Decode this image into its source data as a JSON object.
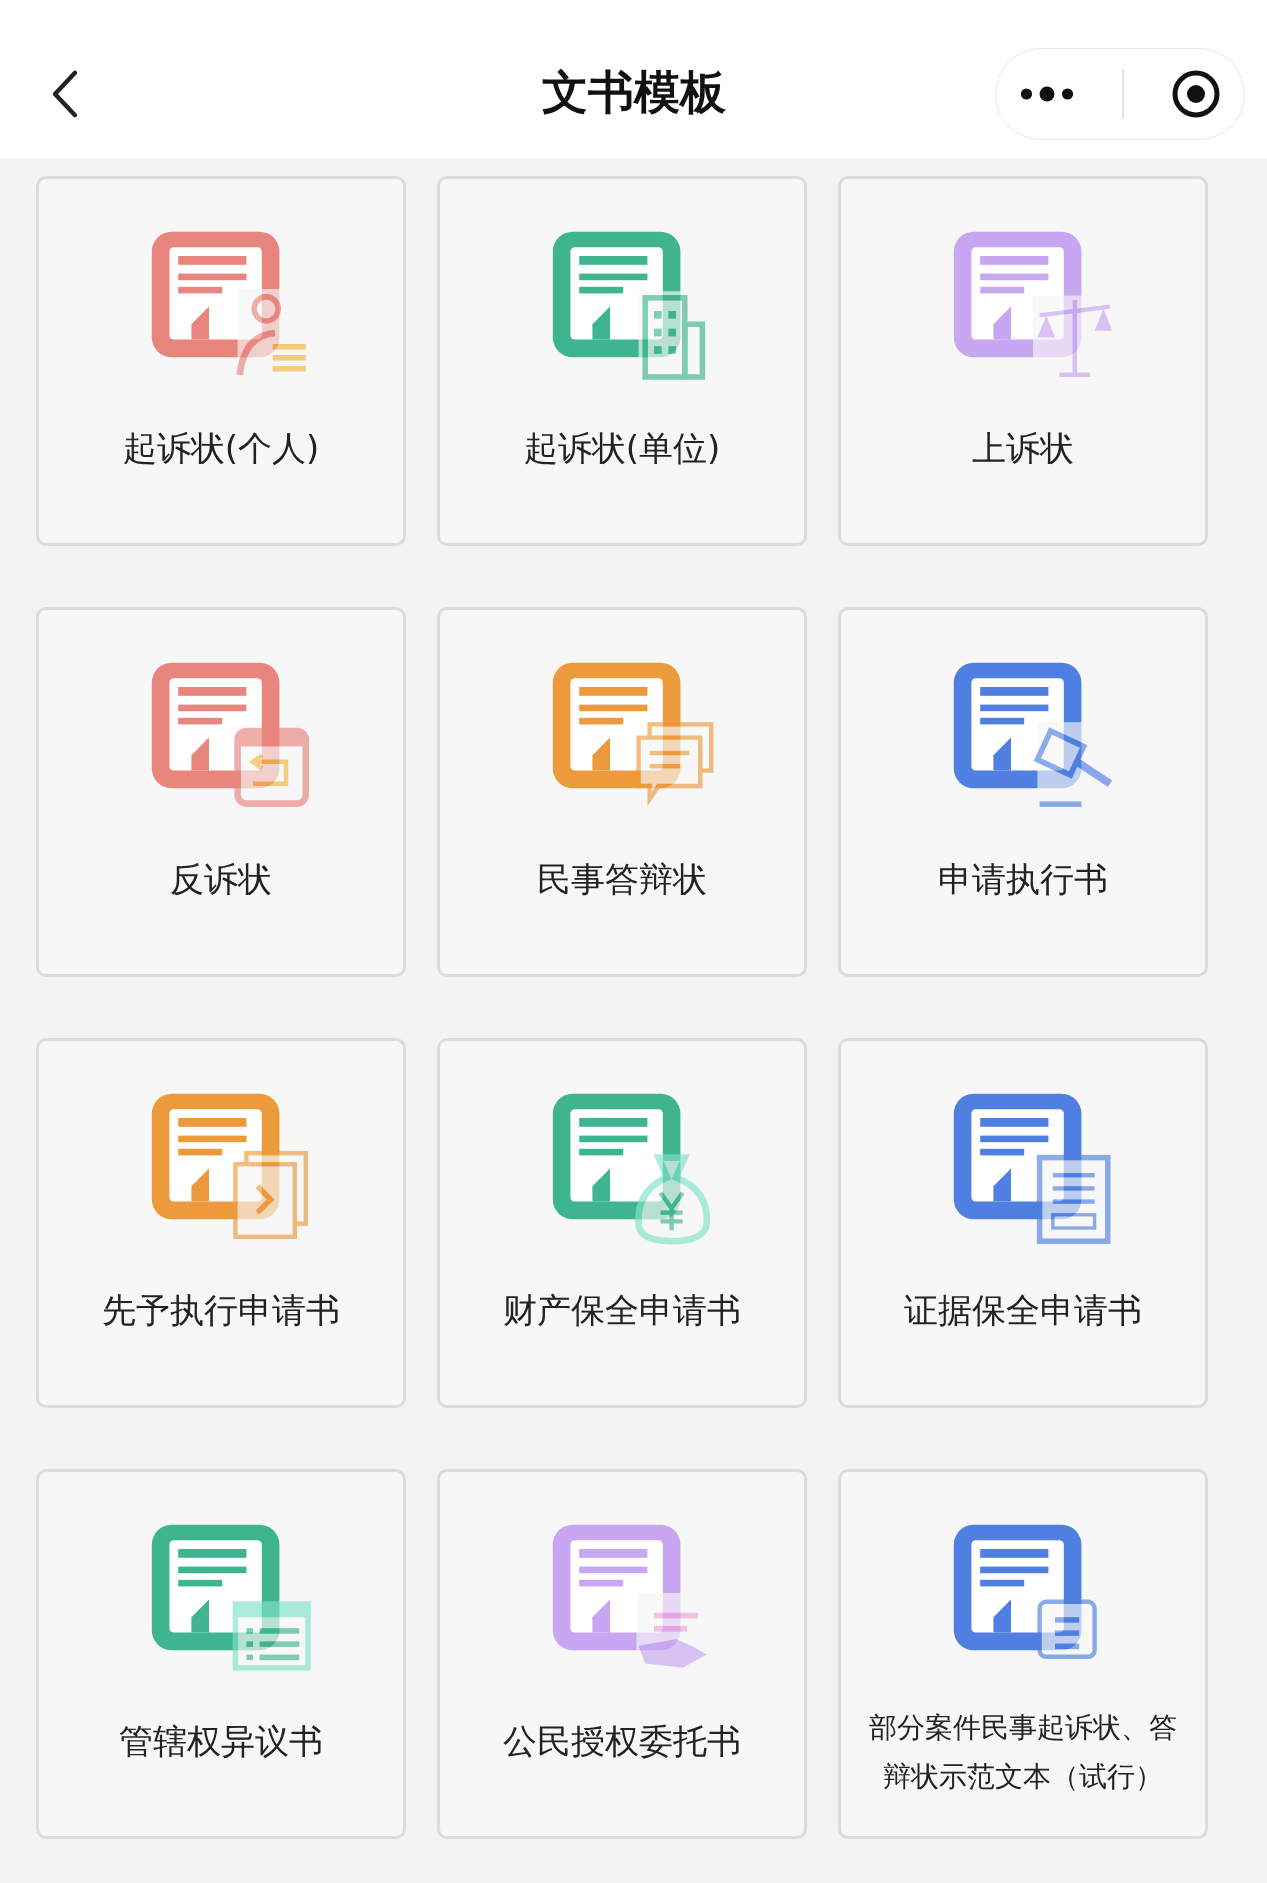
{
  "header": {
    "title": "文书模板"
  },
  "templates": [
    {
      "label": "起诉状(个人)",
      "color": "#e8857c",
      "kind": "person"
    },
    {
      "label": "起诉状(单位)",
      "color": "#3fb58f",
      "kind": "building"
    },
    {
      "label": "上诉状",
      "color": "#c7a6f2",
      "kind": "scale"
    },
    {
      "label": "反诉状",
      "color": "#e8857c",
      "kind": "calendar"
    },
    {
      "label": "民事答辩状",
      "color": "#ec9a3c",
      "kind": "chat"
    },
    {
      "label": "申请执行书",
      "color": "#4f7fe0",
      "kind": "gavel"
    },
    {
      "label": "先予执行申请书",
      "color": "#ec9a3c",
      "kind": "forward"
    },
    {
      "label": "财产保全申请书",
      "color": "#3fb58f",
      "kind": "moneybag"
    },
    {
      "label": "证据保全申请书",
      "color": "#4f7fe0",
      "kind": "paper"
    },
    {
      "label": "管辖权异议书",
      "color": "#3fb58f",
      "kind": "list"
    },
    {
      "label": "公民授权委托书",
      "color": "#c7a6f2",
      "kind": "hand"
    },
    {
      "label": "部分案件民事起诉状、答辩状示范文本（试行）",
      "color": "#4f7fe0",
      "kind": "card"
    }
  ]
}
